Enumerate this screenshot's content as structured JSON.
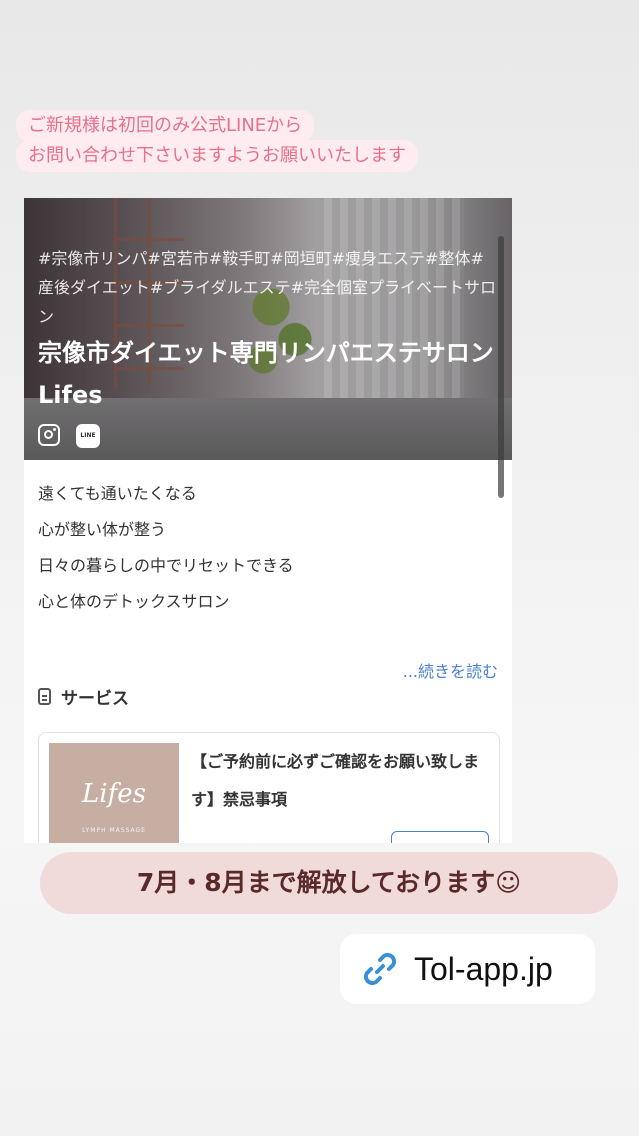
{
  "notice": {
    "line1": "ご新規様は初回のみ公式LINEから",
    "line2": "お問い合わせ下さいますようお願いいたします"
  },
  "hero": {
    "hashtags": "#宗像市リンパ#宮若市#鞍手町#岡垣町#痩身エステ#整体#産後ダイエット#ブライダルエステ#完全個室プライベートサロン",
    "title": "宗像市ダイエット専門リンパエステサロンLifes",
    "social": [
      "instagram-icon",
      "line-icon"
    ],
    "line_icon_text": "LINE"
  },
  "description": {
    "lines": [
      "遠くても通いたくなる",
      "心が整い体が整う",
      "日々の暮らしの中でリセットできる",
      "心と体のデトックスサロン"
    ],
    "read_more": "...続きを読む"
  },
  "services": {
    "heading": "サービス",
    "card": {
      "thumb_logo": "Lifes",
      "thumb_sub": "LYMPH MASSAGE",
      "text": "【ご予約前に必ずご確認をお願い致します】禁忌事項"
    }
  },
  "banner": {
    "text": "7月・8月まで解放しております☺"
  },
  "link": {
    "text": "Tol-app.jp",
    "icon": "link-icon"
  },
  "colors": {
    "notice_text": "#e8718a",
    "notice_bg": "#ffecf0",
    "link_blue": "#4a7fd1",
    "banner_bg": "#f0d7d7",
    "banner_text": "#5a2a2a",
    "link_icon": "#3a8fd8"
  }
}
